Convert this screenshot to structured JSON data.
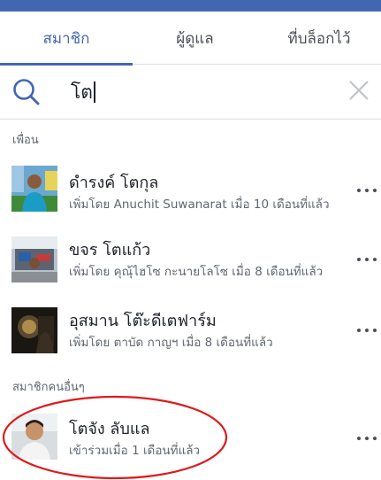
{
  "tabs": [
    {
      "label": "สมาชิก",
      "active": true
    },
    {
      "label": "ผู้ดูแล",
      "active": false
    },
    {
      "label": "ที่บล็อกไว้",
      "active": false
    }
  ],
  "search": {
    "value": "โต"
  },
  "sections": {
    "friends_header": "เพื่อน",
    "others_header": "สมาชิกคนอื่นๆ"
  },
  "friends": [
    {
      "name": "ดำรงค์ โตกุล",
      "meta": "เพิ่มโดย Anuchit Suwanarat เมื่อ 10 เดือนที่แล้ว"
    },
    {
      "name": "ขจร โตแก้ว",
      "meta": "เพิ่มโดย คุณุ้ไฮโซ กะนายโลโซ เมื่อ 8 เดือนที่แล้ว"
    },
    {
      "name": "อุสมาน โต๊ะดีเตฟาร์ม",
      "meta": "เพิ่มโดย ตาบัด กาญฯ เมื่อ 8 เดือนที่แล้ว"
    }
  ],
  "others": [
    {
      "name": "โตจัง ลับแล",
      "meta": "เข้าร่วมเมื่อ 1 เดือนที่แล้ว"
    }
  ],
  "colors": {
    "accent": "#4267b2",
    "annotation": "#e0191b"
  }
}
